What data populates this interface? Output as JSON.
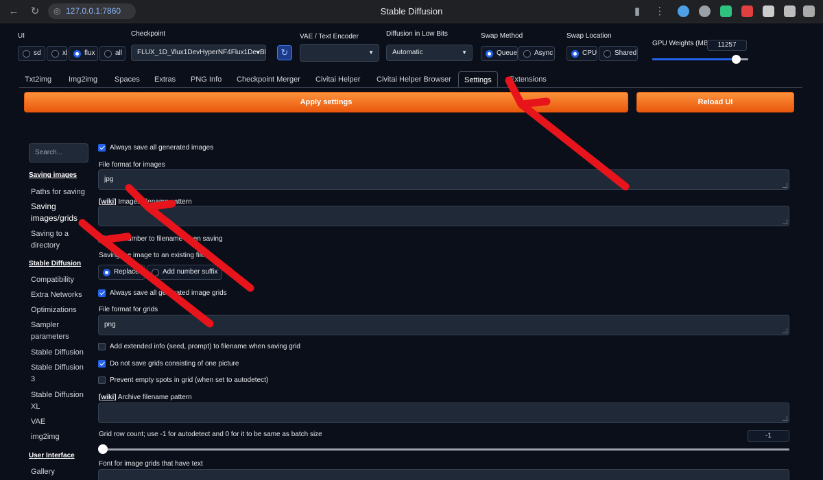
{
  "browser": {
    "url": "127.0.0.1:7860",
    "page_title": "Stable Diffusion",
    "extension_colors": [
      "#4ea0e6",
      "#9aa0a6",
      "#2ec27e",
      "#e04040",
      "#cccccc",
      "#bdbdbd",
      "#aaaaaa"
    ]
  },
  "top": {
    "ui_label": "UI",
    "ui_options": [
      "sd",
      "xl",
      "flux",
      "all"
    ],
    "ui_selected": "flux",
    "checkpoint_label": "Checkpoint",
    "checkpoint_value": "FLUX_1D_\\flux1DevHyperNF4Flux1DevBl",
    "vae_label": "VAE / Text Encoder",
    "vae_value": "",
    "lowbits_label": "Diffusion in Low Bits",
    "lowbits_value": "Automatic",
    "swap_method_label": "Swap Method",
    "swap_method_options": [
      "Queue",
      "Async"
    ],
    "swap_method_selected": "Queue",
    "swap_location_label": "Swap Location",
    "swap_location_options": [
      "CPU",
      "Shared"
    ],
    "swap_location_selected": "CPU",
    "gpu_label": "GPU Weights (MB)",
    "gpu_value": "11257",
    "gpu_slider_fraction": 0.87
  },
  "tabs": [
    "Txt2img",
    "Img2img",
    "Spaces",
    "Extras",
    "PNG Info",
    "Checkpoint Merger",
    "Civitai Helper",
    "Civitai Helper Browser",
    "Settings",
    "Extensions"
  ],
  "active_tab": "Settings",
  "actions": {
    "apply": "Apply settings",
    "reload": "Reload UI"
  },
  "sidebar": {
    "search_placeholder": "Search...",
    "sections": [
      {
        "title": "Saving images",
        "items": [
          "Paths for saving",
          "Saving images/grids",
          "Saving to a directory"
        ]
      },
      {
        "title": "Stable Diffusion",
        "items": [
          "Compatibility",
          "Extra Networks",
          "Optimizations",
          "Sampler parameters",
          "Stable Diffusion",
          "Stable Diffusion 3",
          "Stable Diffusion XL",
          "VAE",
          "img2img"
        ]
      },
      {
        "title": "User Interface",
        "items": [
          "Gallery"
        ]
      }
    ],
    "selected_item": "Saving images/grids"
  },
  "settings": {
    "always_save_images": {
      "label": "Always save all generated images",
      "checked": true
    },
    "file_format_label": "File format for images",
    "file_format_value": "jpg",
    "wiki_tag": "[wiki]",
    "images_pattern_label": "Images filename pattern",
    "images_pattern_value": "",
    "add_number_label": "Add number to filename when saving",
    "save_existing_label": "Saving the image to an existing file",
    "save_existing_options": [
      "Replace",
      "Add number suffix"
    ],
    "save_existing_selected": "Replace",
    "always_save_grids": {
      "label": "Always save all generated image grids",
      "checked": true
    },
    "grid_format_label": "File format for grids",
    "grid_format_value": "png",
    "extended_info": {
      "label": "Add extended info (seed, prompt) to filename when saving grid",
      "checked": false
    },
    "no_single_grids": {
      "label": "Do not save grids consisting of one picture",
      "checked": true
    },
    "prevent_empty": {
      "label": "Prevent empty spots in grid (when set to autodetect)",
      "checked": false
    },
    "archive_pattern_label": "Archive filename pattern",
    "archive_pattern_value": "",
    "grid_rows_label": "Grid row count; use -1 for autodetect and 0 for it to be same as batch size",
    "grid_rows_value": "-1",
    "grid_font_label": "Font for image grids that have text"
  },
  "annotation_color": "#e8141c"
}
